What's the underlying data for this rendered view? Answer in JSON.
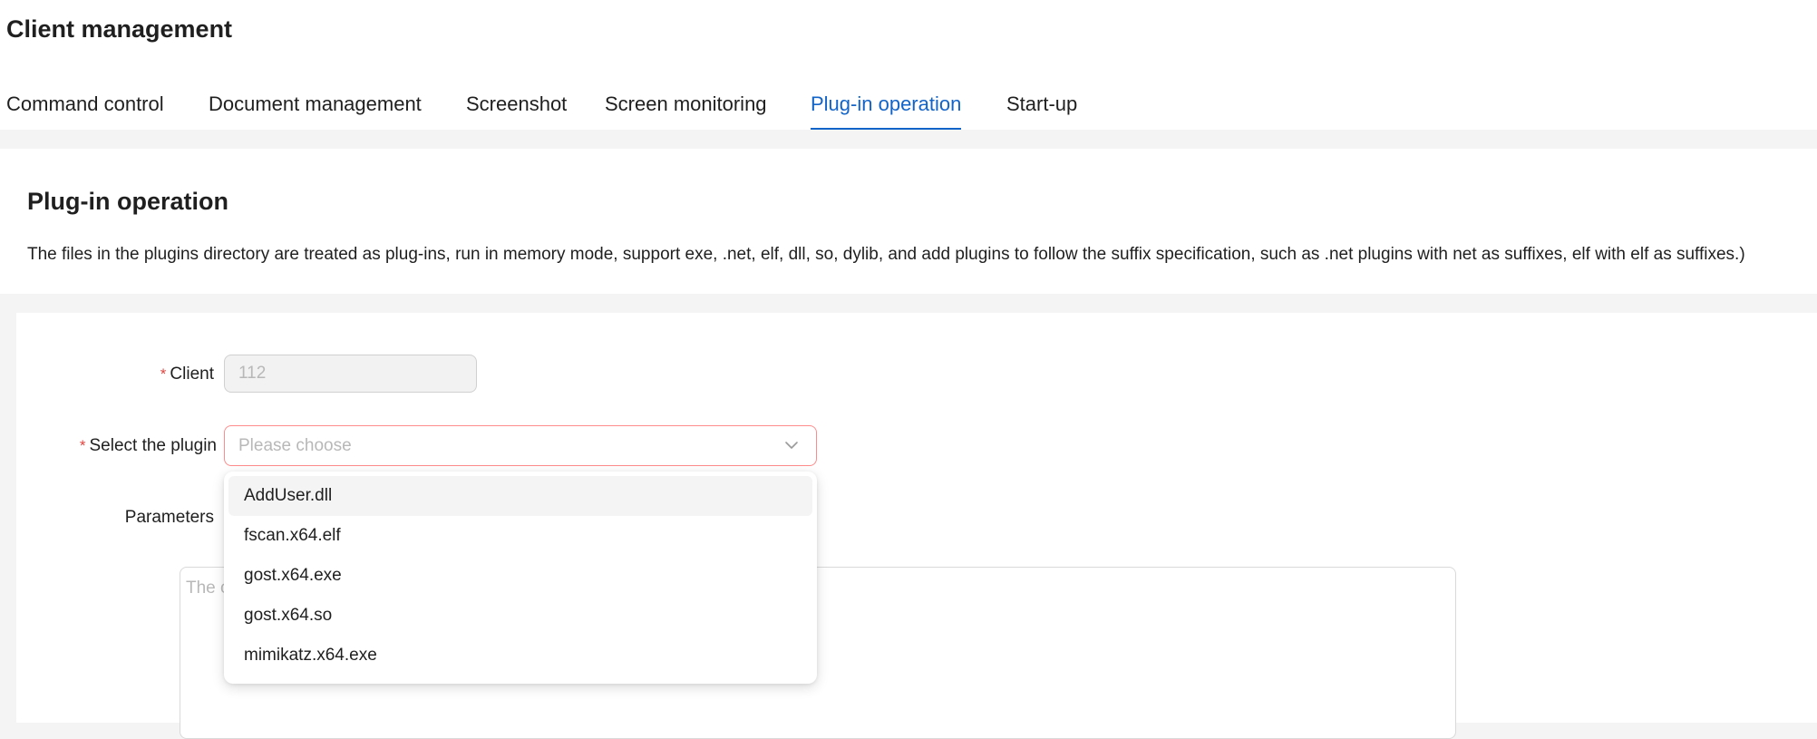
{
  "page": {
    "title": "Client management"
  },
  "tabs": [
    {
      "label": "Command control"
    },
    {
      "label": "Document management"
    },
    {
      "label": "Screenshot"
    },
    {
      "label": "Screen monitoring"
    },
    {
      "label": "Plug-in operation",
      "active": true
    },
    {
      "label": "Start-up"
    }
  ],
  "section": {
    "title": "Plug-in operation",
    "description": "The files in the plugins directory are treated as plug-ins, run in memory mode, support exe, .net, elf, dll, so, dylib, and add plugins to follow the suffix specification, such as .net plugins with net as suffixes, elf with elf as suffixes.)"
  },
  "form": {
    "required_mark": "*",
    "client": {
      "label": "Client",
      "value": "112"
    },
    "plugin": {
      "label": "Select the plugin",
      "placeholder": "Please choose",
      "icon": "chevron-down-icon"
    },
    "parameters": {
      "label": "Parameters"
    },
    "output": {
      "placeholder": "The c"
    }
  },
  "dropdown": {
    "options": [
      "AddUser.dll",
      "fscan.x64.elf",
      "gost.x64.exe",
      "gost.x64.so",
      "mimikatz.x64.exe"
    ],
    "highlighted_index": 0
  },
  "colors": {
    "accent": "#1264c8",
    "required": "#e0453f",
    "error_border": "#ff8c8c",
    "page_bg": "#f4f4f4"
  }
}
